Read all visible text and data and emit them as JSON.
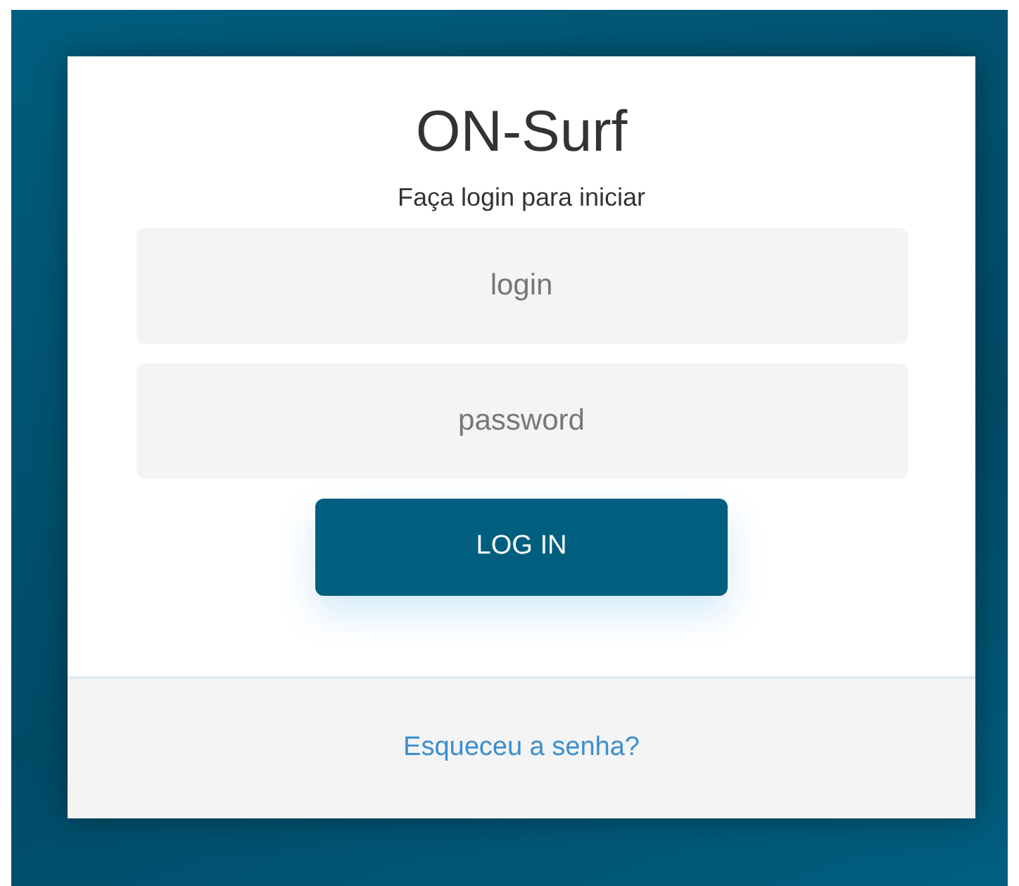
{
  "title": "ON-Surf",
  "subtitle": "Faça login para iniciar",
  "fields": [
    {
      "placeholder": "login"
    },
    {
      "placeholder": "password"
    }
  ],
  "button": "LOG IN",
  "footer_link": "Esqueceu a senha?"
}
